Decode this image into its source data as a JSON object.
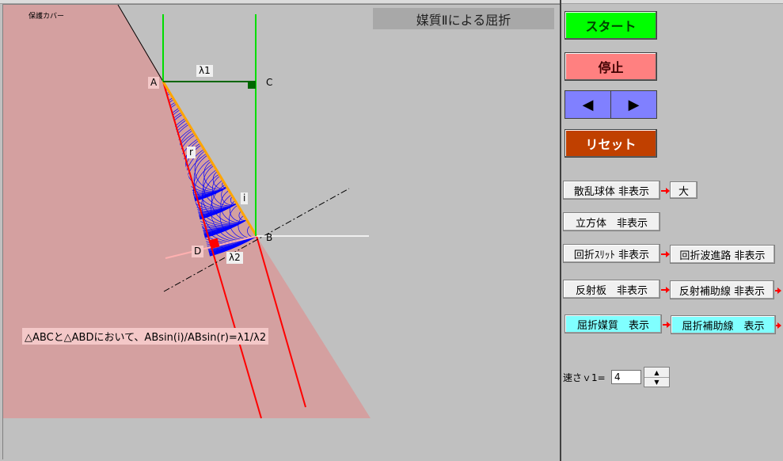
{
  "canvas": {
    "cover_label": "保護カバー",
    "title": "媒質Ⅱによる屈折",
    "labels": {
      "A": "A",
      "B": "B",
      "C": "C",
      "D": "D",
      "lambda1": "λ1",
      "lambda2": "λ2",
      "r": "r",
      "i": "i"
    },
    "formula": "△ABCと△ABDにおいて、ABsin(i)/ABsin(r)=λ1/λ2",
    "colors": {
      "medium": "#d4a0a0",
      "wavefront": "#0000ff",
      "ray": "#ff0000",
      "guide": "#00cc00",
      "interface": "#ffa500"
    }
  },
  "controls": {
    "start": "スタート",
    "stop": "停止",
    "prev_icon": "◀",
    "next_icon": "▶",
    "reset": "リセット",
    "scatter_sphere": "散乱球体 非表示",
    "size": "大",
    "cube": "立方体　非表示",
    "slit": "回折ｽﾘｯﾄ 非表示",
    "diffract_path": "回折波進路 非表示",
    "reflector": "反射板　非表示",
    "reflect_guide": "反射補助線 非表示",
    "medium": "屈折媒質　表示",
    "refract_guide": "屈折補助線　表示",
    "speed_label": "速さｖ1=",
    "speed_value": "4"
  }
}
